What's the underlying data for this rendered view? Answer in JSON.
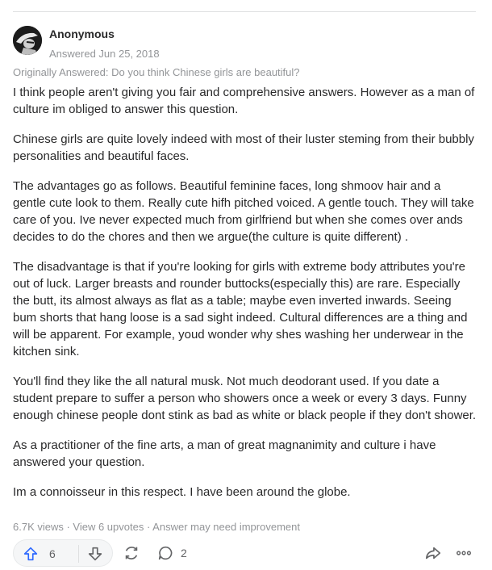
{
  "author": {
    "name": "Anonymous",
    "answered_date": "Answered Jun 25, 2018"
  },
  "original_question": "Originally Answered: Do you think Chinese girls are beautiful?",
  "paragraphs": [
    "I think people aren't giving you fair and comprehensive answers. However as a man of culture im obliged to answer this question.",
    "Chinese girls are quite lovely indeed with most of their luster steming from their bubbly personalities and beautiful faces.",
    "The advantages go as follows. Beautiful feminine faces, long shmoov hair and a gentle cute look to them. Really cute hifh pitched voiced. A gentle touch. They will take care of you. Ive never expected much from girlfriend but when she comes over ands decides to do the chores and then we argue(the culture is quite different) .",
    "The disadvantage is that if you're looking for girls with extreme body attributes you're out of luck. Larger breasts and rounder buttocks(especially this) are rare. Especially the butt, its almost always as flat as a table; maybe even inverted inwards. Seeing bum shorts that hang loose is a sad sight indeed. Cultural differences are a thing and will be apparent. For example, youd wonder why shes washing her underwear in the kitchen sink.",
    "You'll find they like the all natural musk. Not much deodorant used. If you date a student prepare to suffer a person who showers once a week or every 3 days. Funny enough chinese people dont stink as bad as white or black people if they don't shower.",
    "As a practitioner of the fine arts, a man of great magnanimity and culture i have answered your question.",
    "Im a connoisseur in this respect. I have been around the globe."
  ],
  "meta": "6.7K views · View 6 upvotes · Answer may need improvement",
  "actions": {
    "upvote_count": "6",
    "comment_count": "2",
    "icons": [
      "upvote-icon",
      "downvote-icon",
      "reshare-icon",
      "comment-icon",
      "share-icon",
      "more-icon"
    ]
  },
  "colors": {
    "text": "#282829",
    "muted": "#939598",
    "upvote": "#2e69ff",
    "icon": "#636466"
  }
}
